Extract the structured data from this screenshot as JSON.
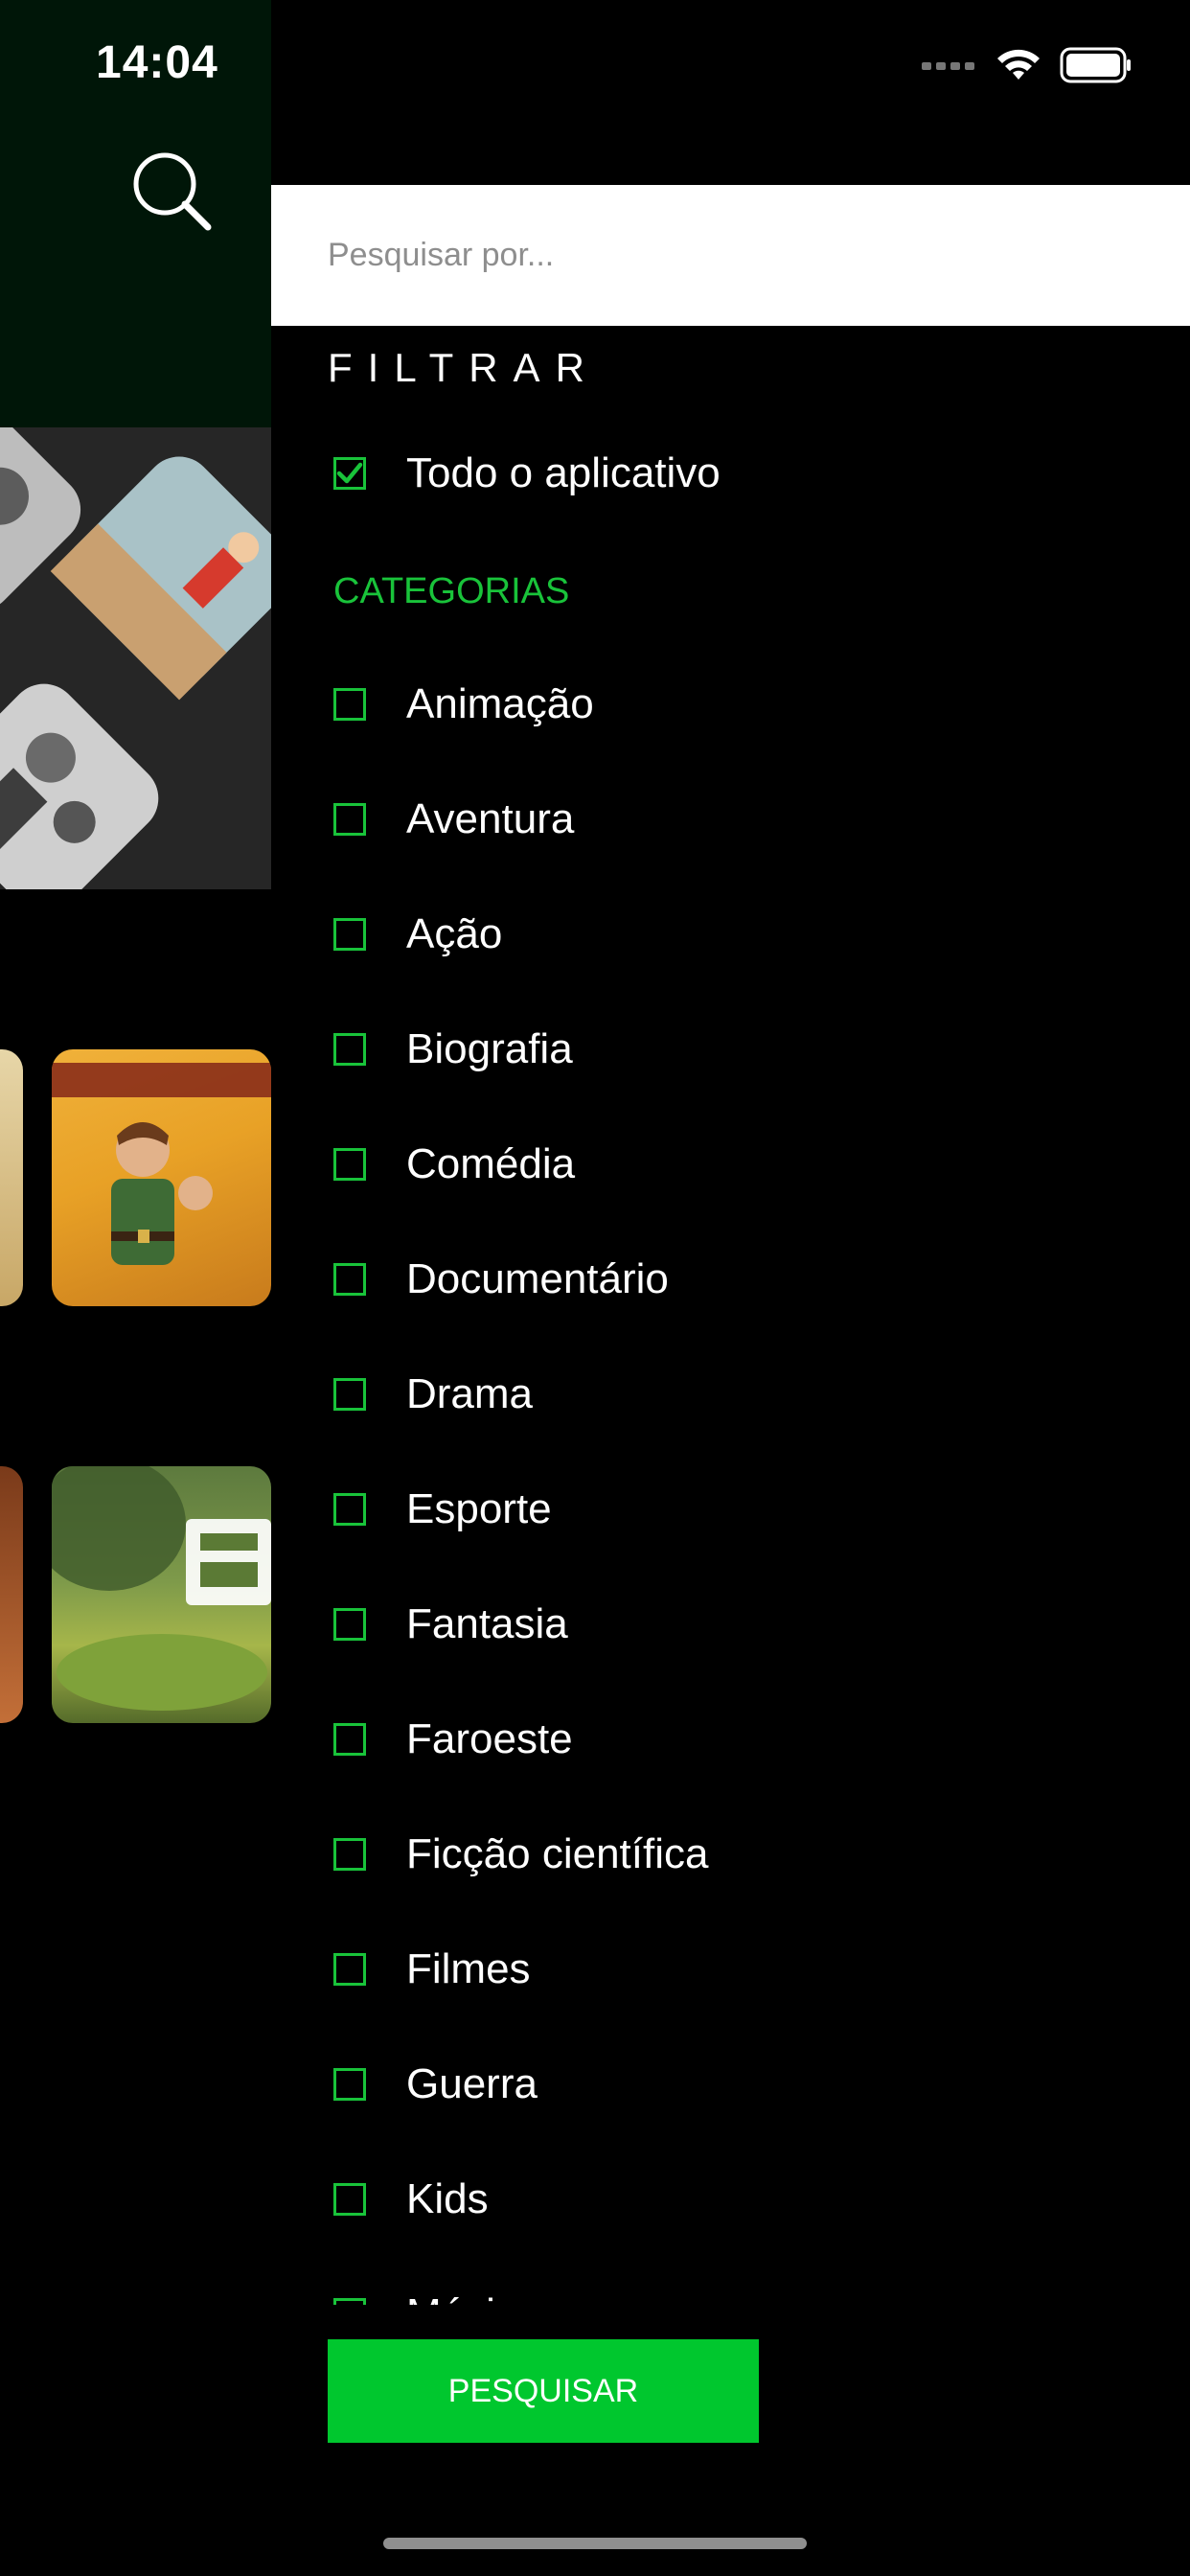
{
  "status_bar": {
    "time": "14:04"
  },
  "search": {
    "placeholder": "Pesquisar por..."
  },
  "filter": {
    "title": "FILTRAR",
    "all_app_label": "Todo o aplicativo",
    "all_app_checked": true,
    "categories_title": "CATEGORIAS",
    "categories": [
      {
        "label": "Animação",
        "checked": false
      },
      {
        "label": "Aventura",
        "checked": false
      },
      {
        "label": "Ação",
        "checked": false
      },
      {
        "label": "Biografia",
        "checked": false
      },
      {
        "label": "Comédia",
        "checked": false
      },
      {
        "label": "Documentário",
        "checked": false
      },
      {
        "label": "Drama",
        "checked": false
      },
      {
        "label": "Esporte",
        "checked": false
      },
      {
        "label": "Fantasia",
        "checked": false
      },
      {
        "label": "Faroeste",
        "checked": false
      },
      {
        "label": "Ficção científica",
        "checked": false
      },
      {
        "label": "Filmes",
        "checked": false
      },
      {
        "label": "Guerra",
        "checked": false
      },
      {
        "label": "Kids",
        "checked": false
      },
      {
        "label": "Música",
        "checked": false
      }
    ]
  },
  "actions": {
    "search_button_label": "PESQUISAR"
  },
  "colors": {
    "accent": "#00c72e",
    "checkbox_border": "#19c33a",
    "background": "#000000",
    "header_bg": "#001608"
  },
  "icons": {
    "background_search": "search-icon",
    "wifi": "wifi-icon",
    "battery": "battery-icon",
    "signal": "signal-icon",
    "checkmark": "checkmark-icon"
  }
}
